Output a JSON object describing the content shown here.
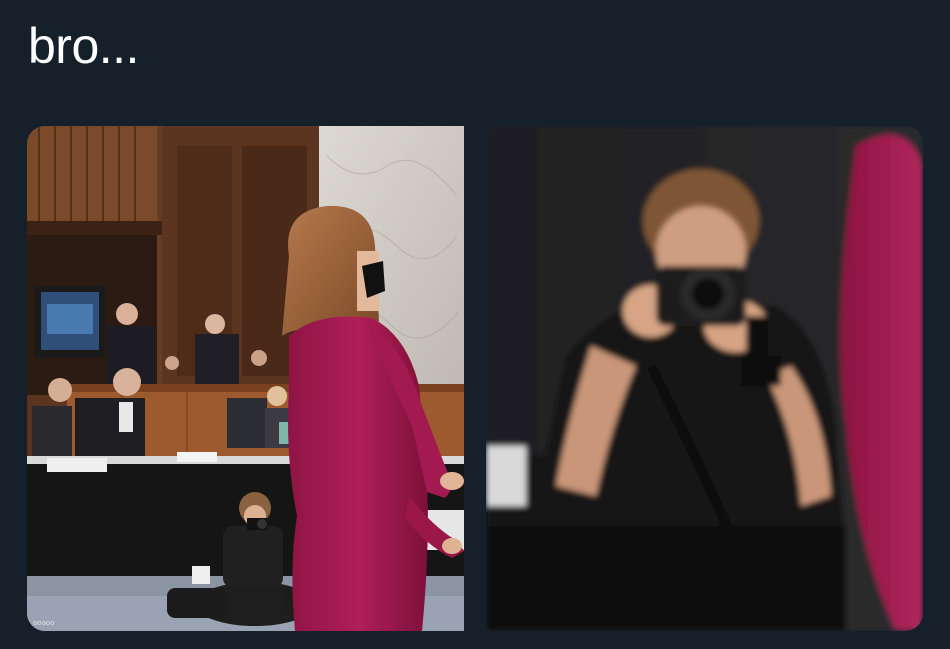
{
  "tweet": {
    "text": "bro..."
  },
  "media": {
    "images": [
      {
        "name": "hearing-room-photo",
        "watermark": "ooooo"
      },
      {
        "name": "photographer-zoom-photo"
      }
    ]
  },
  "colors": {
    "background": "#15202b",
    "text": "#ffffff",
    "dress": "#a3194f"
  }
}
